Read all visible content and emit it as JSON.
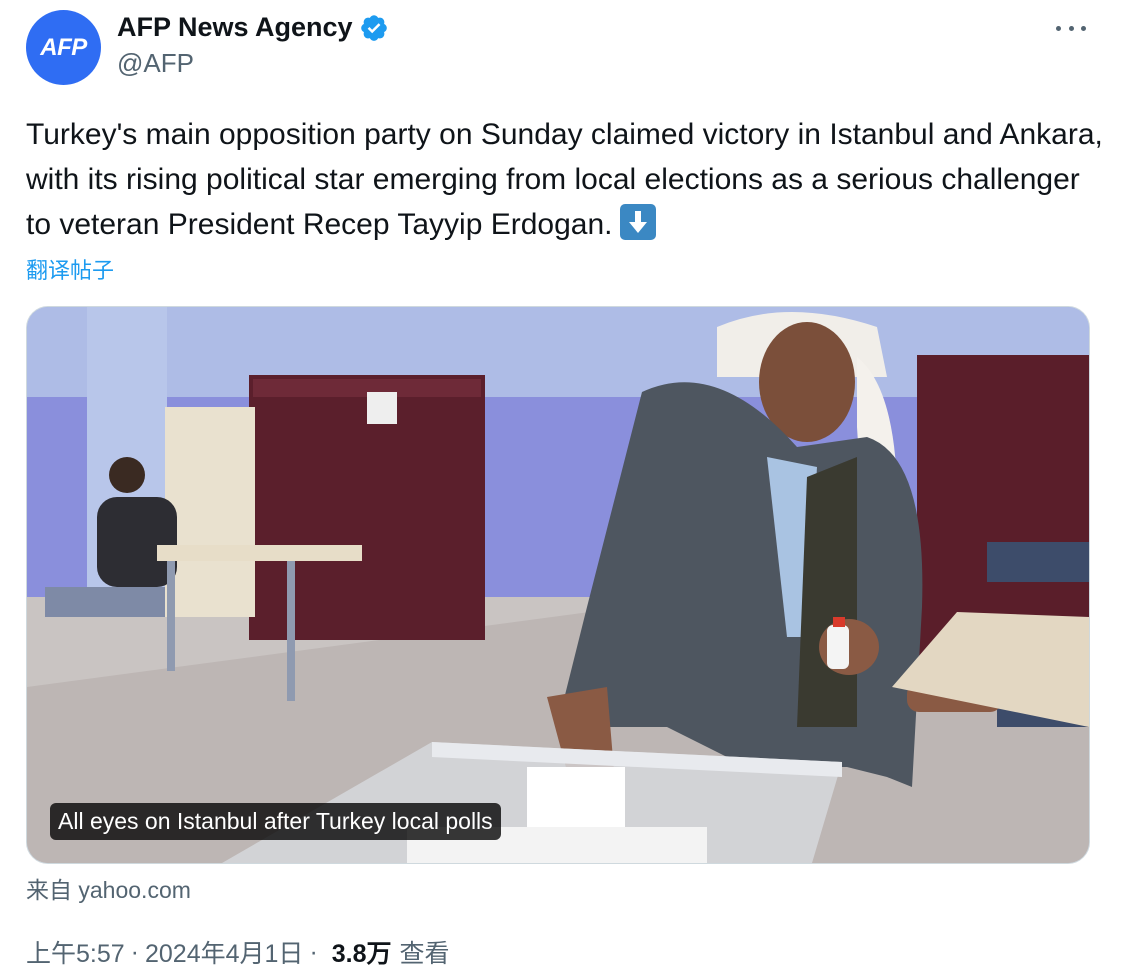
{
  "author": {
    "avatar_text": "AFP",
    "display_name": "AFP News Agency",
    "handle": "@AFP"
  },
  "tweet": {
    "text": "Turkey's main opposition party on Sunday claimed victory in Istanbul and Ankara, with its rising political star emerging from local elections as a serious challenger to veteran President Recep Tayyip Erdogan.",
    "translate_label": "翻译帖子"
  },
  "media": {
    "caption": "All eyes on Istanbul after Turkey local polls",
    "source": "来自 yahoo.com"
  },
  "meta": {
    "time": "上午5:57",
    "date": "2024年4月1日",
    "views_count": "3.8万",
    "views_label": "查看",
    "separator": "·"
  },
  "colors": {
    "accent": "#1d9bf0",
    "avatar_bg": "#2f6df3"
  }
}
